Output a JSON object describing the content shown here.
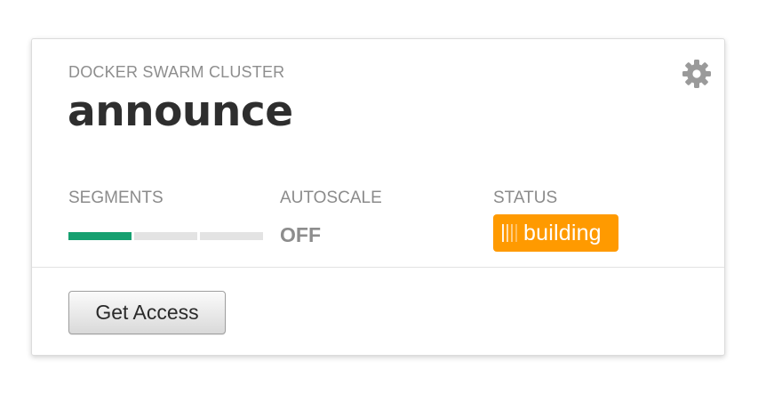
{
  "card": {
    "type_label": "DOCKER SWARM CLUSTER",
    "name": "announce",
    "settings_icon": "gear-icon"
  },
  "segments": {
    "label": "SEGMENTS",
    "total": 3,
    "active": 1,
    "active_color": "#16a070",
    "inactive_color": "#e3e3e3"
  },
  "autoscale": {
    "label": "AUTOSCALE",
    "value": "OFF"
  },
  "status": {
    "label": "STATUS",
    "value": "building",
    "color": "#ff9a00",
    "icon": "progress-stripes-icon"
  },
  "actions": {
    "get_access_label": "Get Access"
  }
}
